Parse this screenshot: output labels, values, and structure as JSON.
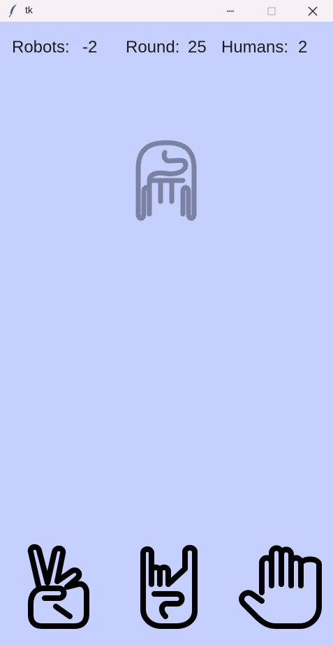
{
  "window": {
    "title": "tk",
    "icon": "feather-icon",
    "controls": [
      "minimize-icon",
      "maximize-icon",
      "close-icon"
    ]
  },
  "scoreboard": {
    "robots_label": "Robots:",
    "robots_value": "-2",
    "round_label": "Round:",
    "round_value": "25",
    "humans_label": "Humans:",
    "humans_value": "2"
  },
  "robot_choice": {
    "icon": "rock-fist-icon"
  },
  "human_choices": [
    {
      "icon": "scissors-hand-icon"
    },
    {
      "icon": "lizard-horns-hand-icon"
    },
    {
      "icon": "paper-open-hand-icon"
    }
  ],
  "colors": {
    "background": "#c5d0ff",
    "titlebar": "#f7f0f5",
    "text": "#1d1d1d",
    "icon": "#000000",
    "robot_icon": "#3a4058"
  }
}
